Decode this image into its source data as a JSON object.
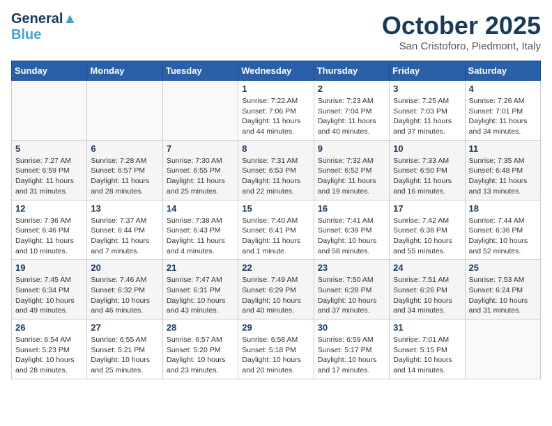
{
  "header": {
    "logo_line1_part1": "General",
    "logo_line1_part2": "Blue",
    "month_title": "October 2025",
    "location": "San Cristoforo, Piedmont, Italy"
  },
  "days_of_week": [
    "Sunday",
    "Monday",
    "Tuesday",
    "Wednesday",
    "Thursday",
    "Friday",
    "Saturday"
  ],
  "weeks": [
    {
      "days": [
        {
          "num": "",
          "info": ""
        },
        {
          "num": "",
          "info": ""
        },
        {
          "num": "",
          "info": ""
        },
        {
          "num": "1",
          "info": "Sunrise: 7:22 AM\nSunset: 7:06 PM\nDaylight: 11 hours and 44 minutes."
        },
        {
          "num": "2",
          "info": "Sunrise: 7:23 AM\nSunset: 7:04 PM\nDaylight: 11 hours and 40 minutes."
        },
        {
          "num": "3",
          "info": "Sunrise: 7:25 AM\nSunset: 7:03 PM\nDaylight: 11 hours and 37 minutes."
        },
        {
          "num": "4",
          "info": "Sunrise: 7:26 AM\nSunset: 7:01 PM\nDaylight: 11 hours and 34 minutes."
        }
      ]
    },
    {
      "days": [
        {
          "num": "5",
          "info": "Sunrise: 7:27 AM\nSunset: 6:59 PM\nDaylight: 11 hours and 31 minutes."
        },
        {
          "num": "6",
          "info": "Sunrise: 7:28 AM\nSunset: 6:57 PM\nDaylight: 11 hours and 28 minutes."
        },
        {
          "num": "7",
          "info": "Sunrise: 7:30 AM\nSunset: 6:55 PM\nDaylight: 11 hours and 25 minutes."
        },
        {
          "num": "8",
          "info": "Sunrise: 7:31 AM\nSunset: 6:53 PM\nDaylight: 11 hours and 22 minutes."
        },
        {
          "num": "9",
          "info": "Sunrise: 7:32 AM\nSunset: 6:52 PM\nDaylight: 11 hours and 19 minutes."
        },
        {
          "num": "10",
          "info": "Sunrise: 7:33 AM\nSunset: 6:50 PM\nDaylight: 11 hours and 16 minutes."
        },
        {
          "num": "11",
          "info": "Sunrise: 7:35 AM\nSunset: 6:48 PM\nDaylight: 11 hours and 13 minutes."
        }
      ]
    },
    {
      "days": [
        {
          "num": "12",
          "info": "Sunrise: 7:36 AM\nSunset: 6:46 PM\nDaylight: 11 hours and 10 minutes."
        },
        {
          "num": "13",
          "info": "Sunrise: 7:37 AM\nSunset: 6:44 PM\nDaylight: 11 hours and 7 minutes."
        },
        {
          "num": "14",
          "info": "Sunrise: 7:38 AM\nSunset: 6:43 PM\nDaylight: 11 hours and 4 minutes."
        },
        {
          "num": "15",
          "info": "Sunrise: 7:40 AM\nSunset: 6:41 PM\nDaylight: 11 hours and 1 minute."
        },
        {
          "num": "16",
          "info": "Sunrise: 7:41 AM\nSunset: 6:39 PM\nDaylight: 10 hours and 58 minutes."
        },
        {
          "num": "17",
          "info": "Sunrise: 7:42 AM\nSunset: 6:38 PM\nDaylight: 10 hours and 55 minutes."
        },
        {
          "num": "18",
          "info": "Sunrise: 7:44 AM\nSunset: 6:36 PM\nDaylight: 10 hours and 52 minutes."
        }
      ]
    },
    {
      "days": [
        {
          "num": "19",
          "info": "Sunrise: 7:45 AM\nSunset: 6:34 PM\nDaylight: 10 hours and 49 minutes."
        },
        {
          "num": "20",
          "info": "Sunrise: 7:46 AM\nSunset: 6:32 PM\nDaylight: 10 hours and 46 minutes."
        },
        {
          "num": "21",
          "info": "Sunrise: 7:47 AM\nSunset: 6:31 PM\nDaylight: 10 hours and 43 minutes."
        },
        {
          "num": "22",
          "info": "Sunrise: 7:49 AM\nSunset: 6:29 PM\nDaylight: 10 hours and 40 minutes."
        },
        {
          "num": "23",
          "info": "Sunrise: 7:50 AM\nSunset: 6:28 PM\nDaylight: 10 hours and 37 minutes."
        },
        {
          "num": "24",
          "info": "Sunrise: 7:51 AM\nSunset: 6:26 PM\nDaylight: 10 hours and 34 minutes."
        },
        {
          "num": "25",
          "info": "Sunrise: 7:53 AM\nSunset: 6:24 PM\nDaylight: 10 hours and 31 minutes."
        }
      ]
    },
    {
      "days": [
        {
          "num": "26",
          "info": "Sunrise: 6:54 AM\nSunset: 5:23 PM\nDaylight: 10 hours and 28 minutes."
        },
        {
          "num": "27",
          "info": "Sunrise: 6:55 AM\nSunset: 5:21 PM\nDaylight: 10 hours and 25 minutes."
        },
        {
          "num": "28",
          "info": "Sunrise: 6:57 AM\nSunset: 5:20 PM\nDaylight: 10 hours and 23 minutes."
        },
        {
          "num": "29",
          "info": "Sunrise: 6:58 AM\nSunset: 5:18 PM\nDaylight: 10 hours and 20 minutes."
        },
        {
          "num": "30",
          "info": "Sunrise: 6:59 AM\nSunset: 5:17 PM\nDaylight: 10 hours and 17 minutes."
        },
        {
          "num": "31",
          "info": "Sunrise: 7:01 AM\nSunset: 5:15 PM\nDaylight: 10 hours and 14 minutes."
        },
        {
          "num": "",
          "info": ""
        }
      ]
    }
  ]
}
